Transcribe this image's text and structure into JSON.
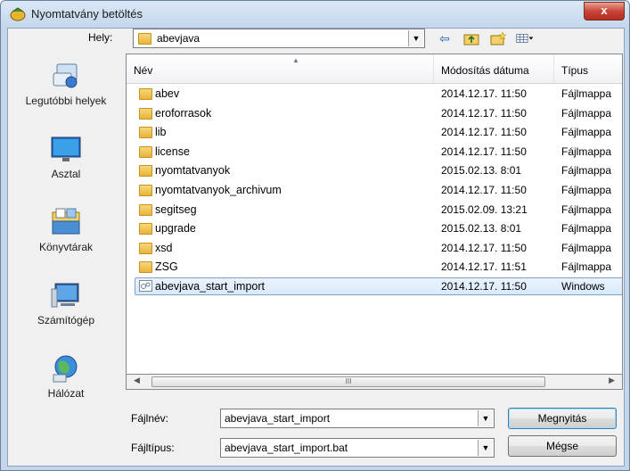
{
  "window": {
    "title": "Nyomtatvány betöltés",
    "close_label": "x"
  },
  "location": {
    "label": "Hely:",
    "value": "abevjava"
  },
  "places": [
    {
      "label": "Legutóbbi helyek",
      "icon": "recent-places-icon"
    },
    {
      "label": "Asztal",
      "icon": "desktop-icon"
    },
    {
      "label": "Könyvtárak",
      "icon": "libraries-icon"
    },
    {
      "label": "Számítógép",
      "icon": "computer-icon"
    },
    {
      "label": "Hálózat",
      "icon": "network-icon"
    }
  ],
  "columns": [
    "Név",
    "Módosítás dátuma",
    "Típus"
  ],
  "files": [
    {
      "name": "abev",
      "date": "2014.12.17. 11:50",
      "type": "Fájlmappa"
    },
    {
      "name": "eroforrasok",
      "date": "2014.12.17. 11:50",
      "type": "Fájlmappa"
    },
    {
      "name": "lib",
      "date": "2014.12.17. 11:50",
      "type": "Fájlmappa"
    },
    {
      "name": "license",
      "date": "2014.12.17. 11:50",
      "type": "Fájlmappa"
    },
    {
      "name": "nyomtatvanyok",
      "date": "2015.02.13. 8:01",
      "type": "Fájlmappa"
    },
    {
      "name": "nyomtatvanyok_archivum",
      "date": "2014.12.17. 11:50",
      "type": "Fájlmappa"
    },
    {
      "name": "segitseg",
      "date": "2015.02.09. 13:21",
      "type": "Fájlmappa"
    },
    {
      "name": "upgrade",
      "date": "2015.02.13. 8:01",
      "type": "Fájlmappa"
    },
    {
      "name": "xsd",
      "date": "2014.12.17. 11:50",
      "type": "Fájlmappa"
    },
    {
      "name": "ZSG",
      "date": "2014.12.17. 11:51",
      "type": "Fájlmappa"
    },
    {
      "name": "abevjava_start_import",
      "date": "2014.12.17. 11:50",
      "type": "Windows"
    }
  ],
  "filename": {
    "label": "Fájlnév:",
    "value": "abevjava_start_import"
  },
  "filetype": {
    "label": "Fájltípus:",
    "value": "abevjava_start_import.bat"
  },
  "buttons": {
    "open": "Megnyitás",
    "cancel": "Mégse"
  },
  "scrollbar": {
    "thumb_grip": "III"
  },
  "colors": {
    "selection": "#d9e9fb",
    "folder": "#e8b43a",
    "close": "#c7473a"
  }
}
